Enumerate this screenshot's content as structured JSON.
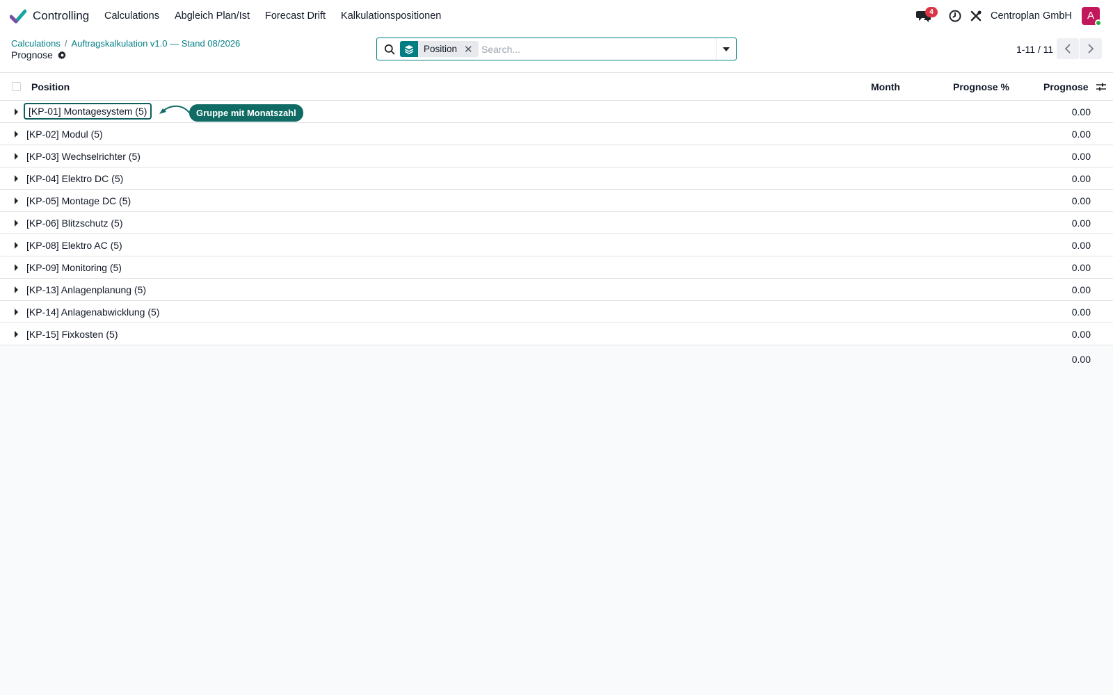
{
  "app": {
    "name": "Controlling",
    "menu": [
      "Calculations",
      "Abgleich Plan/Ist",
      "Forecast Drift",
      "Kalkulationspositionen"
    ],
    "message_count": "4",
    "company": "Centroplan GmbH",
    "avatar_letter": "A",
    "accent_color": "#017e84"
  },
  "breadcrumb": {
    "items": [
      "Calculations",
      "Auftragskalkulation v1.0 — Stand 08/2026"
    ],
    "current": "Prognose"
  },
  "search": {
    "facet_label": "Position",
    "placeholder": "Search..."
  },
  "pager": {
    "value": "1-11 / 11"
  },
  "table": {
    "columns": {
      "position": "Position",
      "month": "Month",
      "prognose_pct": "Prognose %",
      "prognose": "Prognose"
    },
    "groups": [
      {
        "name": "[KP-01] Montagesystem (5)",
        "value": "0.00"
      },
      {
        "name": "[KP-02] Modul (5)",
        "value": "0.00"
      },
      {
        "name": "[KP-03] Wechselrichter (5)",
        "value": "0.00"
      },
      {
        "name": "[KP-04] Elektro DC (5)",
        "value": "0.00"
      },
      {
        "name": "[KP-05] Montage DC (5)",
        "value": "0.00"
      },
      {
        "name": "[KP-06] Blitzschutz (5)",
        "value": "0.00"
      },
      {
        "name": "[KP-08] Elektro AC (5)",
        "value": "0.00"
      },
      {
        "name": "[KP-09] Monitoring (5)",
        "value": "0.00"
      },
      {
        "name": "[KP-13] Anlagenplanung (5)",
        "value": "0.00"
      },
      {
        "name": "[KP-14] Anlagenabwicklung (5)",
        "value": "0.00"
      },
      {
        "name": "[KP-15] Fixkosten (5)",
        "value": "0.00"
      }
    ],
    "total": "0.00"
  },
  "annotation": {
    "label": "Gruppe mit Monatszahl"
  }
}
